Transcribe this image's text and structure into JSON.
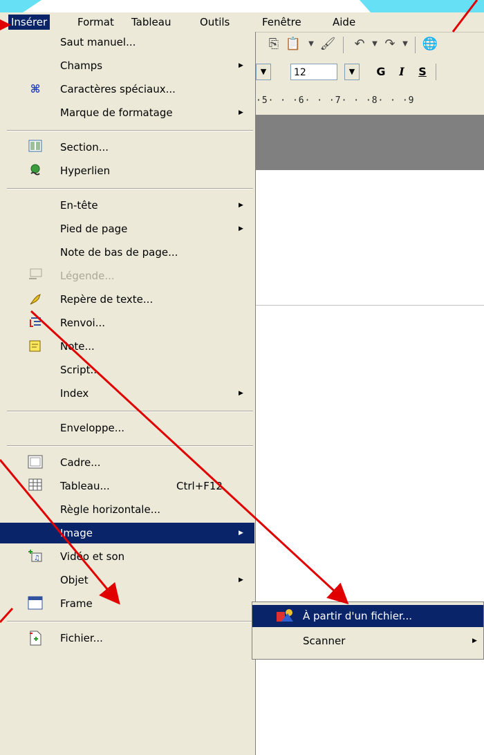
{
  "menubar": {
    "items": [
      "Insérer",
      "Format",
      "Tableau",
      "Outils",
      "Fenêtre",
      "Aide"
    ],
    "active": "Insérer"
  },
  "toolbar": {
    "font_size": "12",
    "bold": "G",
    "italic": "I",
    "underline": "S"
  },
  "ruler": {
    "text": "·5· · ·6· · ·7· · ·8· · ·9"
  },
  "menu": {
    "items": [
      {
        "label": "Saut manuel...",
        "arrow": false,
        "icon": ""
      },
      {
        "label": "Champs",
        "arrow": true,
        "icon": ""
      },
      {
        "label": "Caractères spéciaux...",
        "arrow": false,
        "icon": "command-icon"
      },
      {
        "label": "Marque de formatage",
        "arrow": true,
        "icon": ""
      },
      {
        "label": "Section...",
        "arrow": false,
        "icon": "section-icon"
      },
      {
        "label": "Hyperlien",
        "arrow": false,
        "icon": "hyperlink-globe-icon"
      },
      {
        "label": "En-tête",
        "arrow": true,
        "icon": ""
      },
      {
        "label": "Pied de page",
        "arrow": true,
        "icon": ""
      },
      {
        "label": "Note de bas de page...",
        "arrow": false,
        "icon": ""
      },
      {
        "label": "Légende...",
        "arrow": false,
        "icon": "caption-icon",
        "disabled": true
      },
      {
        "label": "Repère de texte...",
        "arrow": false,
        "icon": "bookmark-pin-icon"
      },
      {
        "label": "Renvoi...",
        "arrow": false,
        "icon": "cross-reference-icon"
      },
      {
        "label": "Note...",
        "arrow": false,
        "icon": "note-icon"
      },
      {
        "label": "Script...",
        "arrow": false,
        "icon": ""
      },
      {
        "label": "Index",
        "arrow": true,
        "icon": ""
      },
      {
        "label": "Enveloppe...",
        "arrow": false,
        "icon": ""
      },
      {
        "label": "Cadre...",
        "arrow": false,
        "icon": "frame-box-icon"
      },
      {
        "label": "Tableau...",
        "arrow": false,
        "icon": "table-icon",
        "shortcut": "Ctrl+F12"
      },
      {
        "label": "Règle horizontale...",
        "arrow": false,
        "icon": ""
      },
      {
        "label": "Image",
        "arrow": true,
        "icon": "",
        "highlight": true
      },
      {
        "label": "Vidéo et son",
        "arrow": false,
        "icon": "video-sound-icon"
      },
      {
        "label": "Objet",
        "arrow": true,
        "icon": ""
      },
      {
        "label": "Frame",
        "arrow": false,
        "icon": "frame-window-icon"
      },
      {
        "label": "Fichier...",
        "arrow": false,
        "icon": "insert-file-icon"
      }
    ]
  },
  "submenu": {
    "items": [
      {
        "label": "À partir d'un fichier...",
        "icon": "image-from-file-icon",
        "arrow": false,
        "highlight": true
      },
      {
        "label": "Scanner",
        "icon": "",
        "arrow": true
      }
    ]
  },
  "colors": {
    "menu_bg": "#ece9d8",
    "highlight": "#0a246a",
    "annotation_red": "#e00000",
    "backdrop_cyan": "#66e0f5"
  }
}
